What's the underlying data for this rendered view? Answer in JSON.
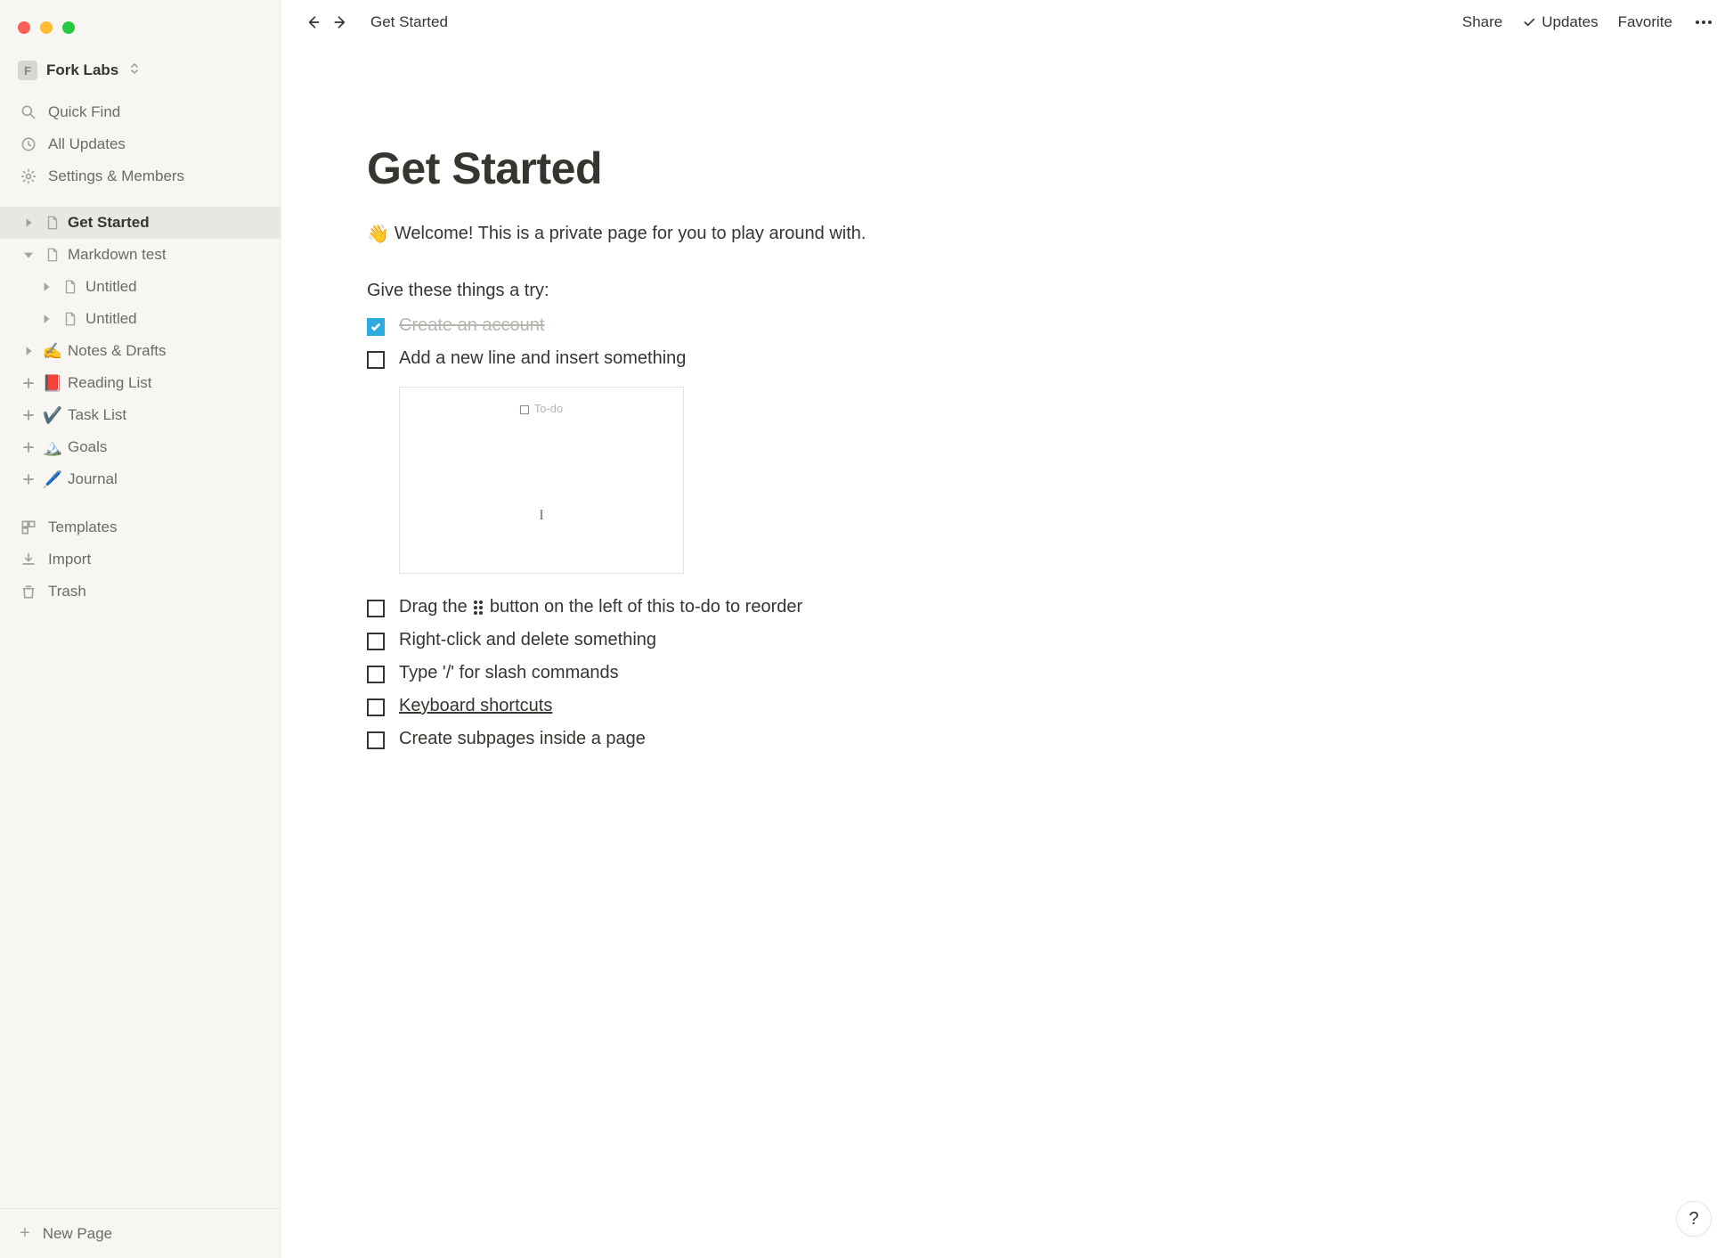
{
  "workspace": {
    "initial": "F",
    "name": "Fork Labs"
  },
  "sidebar": {
    "quick_find": "Quick Find",
    "all_updates": "All Updates",
    "settings": "Settings & Members",
    "templates": "Templates",
    "import": "Import",
    "trash": "Trash",
    "new_page": "New Page",
    "pages": [
      {
        "title": "Get Started",
        "icon": "page",
        "toggle": "closed",
        "selected": true,
        "depth": 0
      },
      {
        "title": "Markdown test",
        "icon": "page",
        "toggle": "open",
        "selected": false,
        "depth": 0
      },
      {
        "title": "Untitled",
        "icon": "page",
        "toggle": "closed",
        "selected": false,
        "depth": 1
      },
      {
        "title": "Untitled",
        "icon": "page",
        "toggle": "closed",
        "selected": false,
        "depth": 1
      },
      {
        "title": "Notes & Drafts",
        "icon": "✍️",
        "toggle": "closed",
        "selected": false,
        "depth": 0
      },
      {
        "title": "Reading List",
        "icon": "📕",
        "toggle": "add",
        "selected": false,
        "depth": 0
      },
      {
        "title": "Task List",
        "icon": "✔️",
        "toggle": "add",
        "selected": false,
        "depth": 0
      },
      {
        "title": "Goals",
        "icon": "🏔️",
        "toggle": "add",
        "selected": false,
        "depth": 0
      },
      {
        "title": "Journal",
        "icon": "🖊️",
        "toggle": "add",
        "selected": false,
        "depth": 0
      }
    ]
  },
  "topbar": {
    "breadcrumb": "Get Started",
    "share": "Share",
    "updates": "Updates",
    "favorite": "Favorite"
  },
  "page": {
    "title": "Get Started",
    "intro_emoji": "👋",
    "intro": "Welcome! This is a private page for you to play around with.",
    "try_heading": "Give these things a try:",
    "embed_placeholder": "To-do",
    "todos": [
      {
        "text": "Create an account",
        "checked": true
      },
      {
        "text": "Add a new line and insert something",
        "checked": false
      },
      {
        "text_prefix": "Drag the ",
        "text_suffix": " button on the left of this to-do to reorder",
        "drag_icon": true,
        "checked": false
      },
      {
        "text": "Right-click and delete something",
        "checked": false
      },
      {
        "text": "Type '/' for slash commands",
        "checked": false
      },
      {
        "text": "Keyboard shortcuts",
        "checked": false,
        "underlined": true
      },
      {
        "text": "Create subpages inside a page",
        "checked": false
      }
    ]
  },
  "help": "?"
}
